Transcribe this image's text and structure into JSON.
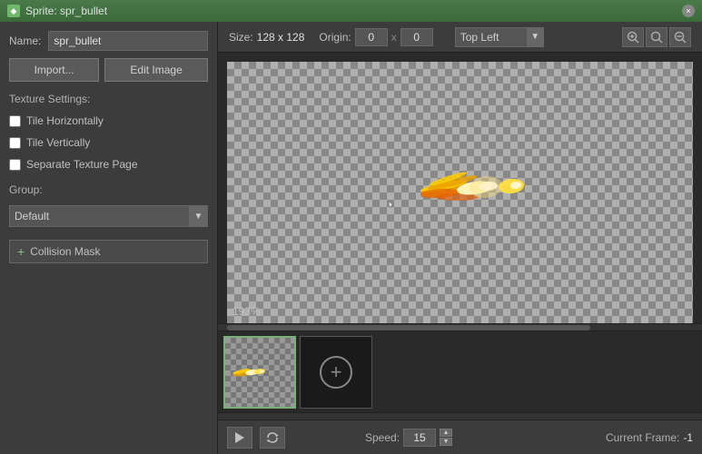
{
  "titleBar": {
    "title": "Sprite: spr_bullet",
    "closeLabel": "×"
  },
  "leftPanel": {
    "nameLabel": "Name:",
    "nameValue": "spr_bullet",
    "importLabel": "Import...",
    "editImageLabel": "Edit Image",
    "textureSettingsLabel": "Texture Settings:",
    "tileHorizontallyLabel": "Tile Horizontally",
    "tileVerticallyLabel": "Tile Vertically",
    "separateTexturePageLabel": "Separate Texture Page",
    "groupLabel": "Group:",
    "groupValue": "Default",
    "collisionMaskLabel": "Collision Mask"
  },
  "infoBar": {
    "sizeLabel": "Size:",
    "sizeValue": "128 x 128",
    "originLabel": "Origin:",
    "originX": "0",
    "originXChar": "x",
    "originY": "0",
    "alignValue": "Top Left",
    "zoomInLabel": "+",
    "zoomFitLabel": "⊡",
    "zoomOutLabel": "−"
  },
  "canvas": {
    "zoomPercent": "193%"
  },
  "bottomBar": {
    "playLabel": "▶",
    "loopLabel": "↺",
    "speedLabel": "Speed:",
    "speedValue": "15",
    "currentFrameLabel": "Current Frame:",
    "currentFrameValue": "-1"
  }
}
